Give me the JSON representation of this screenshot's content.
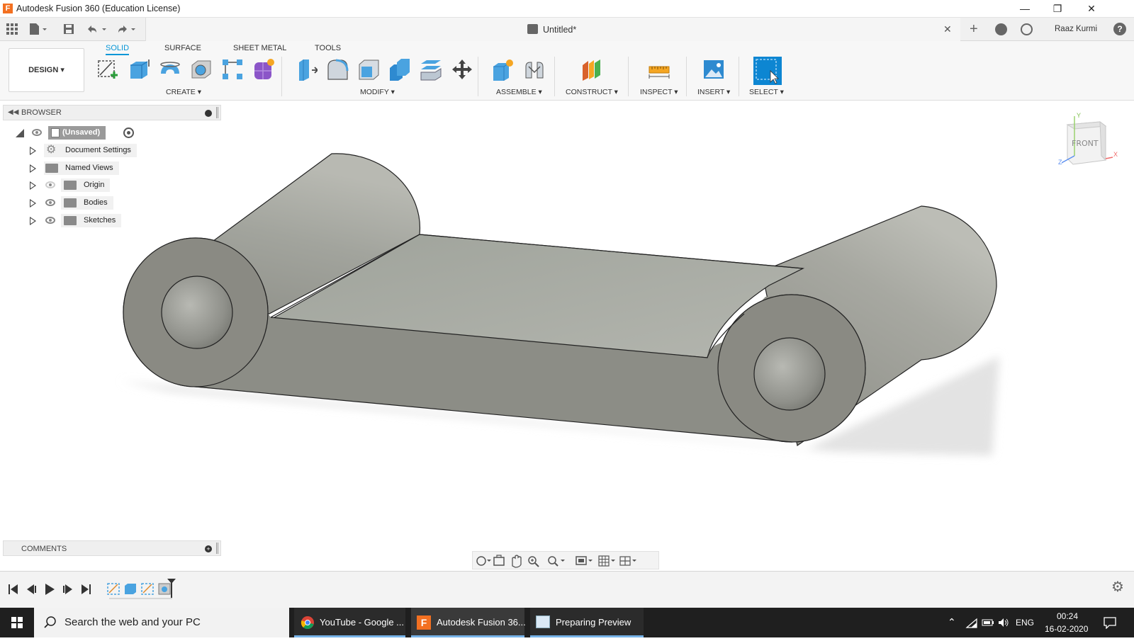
{
  "window": {
    "title": "Autodesk Fusion 360 (Education License)",
    "logo_letter": "F"
  },
  "document": {
    "name": "Untitled*",
    "user": "Raaz Kurmi"
  },
  "ribbon": {
    "workspace": "DESIGN",
    "tabs": [
      "SOLID",
      "SURFACE",
      "SHEET METAL",
      "TOOLS"
    ],
    "active_tab": "SOLID",
    "groups": [
      "CREATE",
      "MODIFY",
      "ASSEMBLE",
      "CONSTRUCT",
      "INSPECT",
      "INSERT",
      "SELECT"
    ]
  },
  "browser": {
    "title": "BROWSER",
    "root": "(Unsaved)",
    "items": [
      "Document Settings",
      "Named Views",
      "Origin",
      "Bodies",
      "Sketches"
    ]
  },
  "comments": {
    "title": "COMMENTS"
  },
  "viewcube": {
    "face": "FRONT",
    "axis_x": "X",
    "axis_y": "Y",
    "axis_z": "Z"
  },
  "taskbar": {
    "search_placeholder": "Search the web and your PC",
    "tasks": [
      "YouTube - Google ...",
      "Autodesk Fusion 36...",
      "Preparing Preview"
    ],
    "language": "ENG",
    "time": "00:24",
    "date": "16-02-2020"
  },
  "colors": {
    "accent": "#0696d7",
    "body_fill": "#a6a7a0",
    "taskbar": "#1f1f1f"
  }
}
